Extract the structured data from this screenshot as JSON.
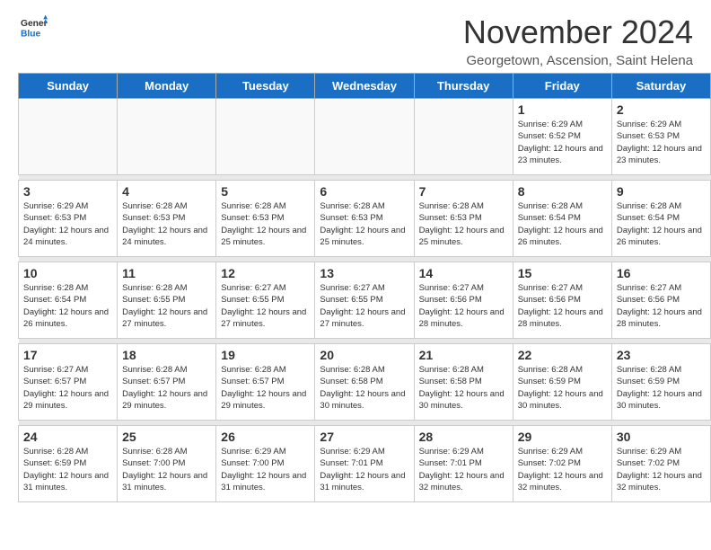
{
  "header": {
    "logo_general": "General",
    "logo_blue": "Blue",
    "month_title": "November 2024",
    "location": "Georgetown, Ascension, Saint Helena"
  },
  "weekdays": [
    "Sunday",
    "Monday",
    "Tuesday",
    "Wednesday",
    "Thursday",
    "Friday",
    "Saturday"
  ],
  "weeks": [
    [
      {
        "day": "",
        "info": ""
      },
      {
        "day": "",
        "info": ""
      },
      {
        "day": "",
        "info": ""
      },
      {
        "day": "",
        "info": ""
      },
      {
        "day": "",
        "info": ""
      },
      {
        "day": "1",
        "info": "Sunrise: 6:29 AM\nSunset: 6:52 PM\nDaylight: 12 hours and 23 minutes."
      },
      {
        "day": "2",
        "info": "Sunrise: 6:29 AM\nSunset: 6:53 PM\nDaylight: 12 hours and 23 minutes."
      }
    ],
    [
      {
        "day": "3",
        "info": "Sunrise: 6:29 AM\nSunset: 6:53 PM\nDaylight: 12 hours and 24 minutes."
      },
      {
        "day": "4",
        "info": "Sunrise: 6:28 AM\nSunset: 6:53 PM\nDaylight: 12 hours and 24 minutes."
      },
      {
        "day": "5",
        "info": "Sunrise: 6:28 AM\nSunset: 6:53 PM\nDaylight: 12 hours and 25 minutes."
      },
      {
        "day": "6",
        "info": "Sunrise: 6:28 AM\nSunset: 6:53 PM\nDaylight: 12 hours and 25 minutes."
      },
      {
        "day": "7",
        "info": "Sunrise: 6:28 AM\nSunset: 6:53 PM\nDaylight: 12 hours and 25 minutes."
      },
      {
        "day": "8",
        "info": "Sunrise: 6:28 AM\nSunset: 6:54 PM\nDaylight: 12 hours and 26 minutes."
      },
      {
        "day": "9",
        "info": "Sunrise: 6:28 AM\nSunset: 6:54 PM\nDaylight: 12 hours and 26 minutes."
      }
    ],
    [
      {
        "day": "10",
        "info": "Sunrise: 6:28 AM\nSunset: 6:54 PM\nDaylight: 12 hours and 26 minutes."
      },
      {
        "day": "11",
        "info": "Sunrise: 6:28 AM\nSunset: 6:55 PM\nDaylight: 12 hours and 27 minutes."
      },
      {
        "day": "12",
        "info": "Sunrise: 6:27 AM\nSunset: 6:55 PM\nDaylight: 12 hours and 27 minutes."
      },
      {
        "day": "13",
        "info": "Sunrise: 6:27 AM\nSunset: 6:55 PM\nDaylight: 12 hours and 27 minutes."
      },
      {
        "day": "14",
        "info": "Sunrise: 6:27 AM\nSunset: 6:56 PM\nDaylight: 12 hours and 28 minutes."
      },
      {
        "day": "15",
        "info": "Sunrise: 6:27 AM\nSunset: 6:56 PM\nDaylight: 12 hours and 28 minutes."
      },
      {
        "day": "16",
        "info": "Sunrise: 6:27 AM\nSunset: 6:56 PM\nDaylight: 12 hours and 28 minutes."
      }
    ],
    [
      {
        "day": "17",
        "info": "Sunrise: 6:27 AM\nSunset: 6:57 PM\nDaylight: 12 hours and 29 minutes."
      },
      {
        "day": "18",
        "info": "Sunrise: 6:28 AM\nSunset: 6:57 PM\nDaylight: 12 hours and 29 minutes."
      },
      {
        "day": "19",
        "info": "Sunrise: 6:28 AM\nSunset: 6:57 PM\nDaylight: 12 hours and 29 minutes."
      },
      {
        "day": "20",
        "info": "Sunrise: 6:28 AM\nSunset: 6:58 PM\nDaylight: 12 hours and 30 minutes."
      },
      {
        "day": "21",
        "info": "Sunrise: 6:28 AM\nSunset: 6:58 PM\nDaylight: 12 hours and 30 minutes."
      },
      {
        "day": "22",
        "info": "Sunrise: 6:28 AM\nSunset: 6:59 PM\nDaylight: 12 hours and 30 minutes."
      },
      {
        "day": "23",
        "info": "Sunrise: 6:28 AM\nSunset: 6:59 PM\nDaylight: 12 hours and 30 minutes."
      }
    ],
    [
      {
        "day": "24",
        "info": "Sunrise: 6:28 AM\nSunset: 6:59 PM\nDaylight: 12 hours and 31 minutes."
      },
      {
        "day": "25",
        "info": "Sunrise: 6:28 AM\nSunset: 7:00 PM\nDaylight: 12 hours and 31 minutes."
      },
      {
        "day": "26",
        "info": "Sunrise: 6:29 AM\nSunset: 7:00 PM\nDaylight: 12 hours and 31 minutes."
      },
      {
        "day": "27",
        "info": "Sunrise: 6:29 AM\nSunset: 7:01 PM\nDaylight: 12 hours and 31 minutes."
      },
      {
        "day": "28",
        "info": "Sunrise: 6:29 AM\nSunset: 7:01 PM\nDaylight: 12 hours and 32 minutes."
      },
      {
        "day": "29",
        "info": "Sunrise: 6:29 AM\nSunset: 7:02 PM\nDaylight: 12 hours and 32 minutes."
      },
      {
        "day": "30",
        "info": "Sunrise: 6:29 AM\nSunset: 7:02 PM\nDaylight: 12 hours and 32 minutes."
      }
    ]
  ]
}
